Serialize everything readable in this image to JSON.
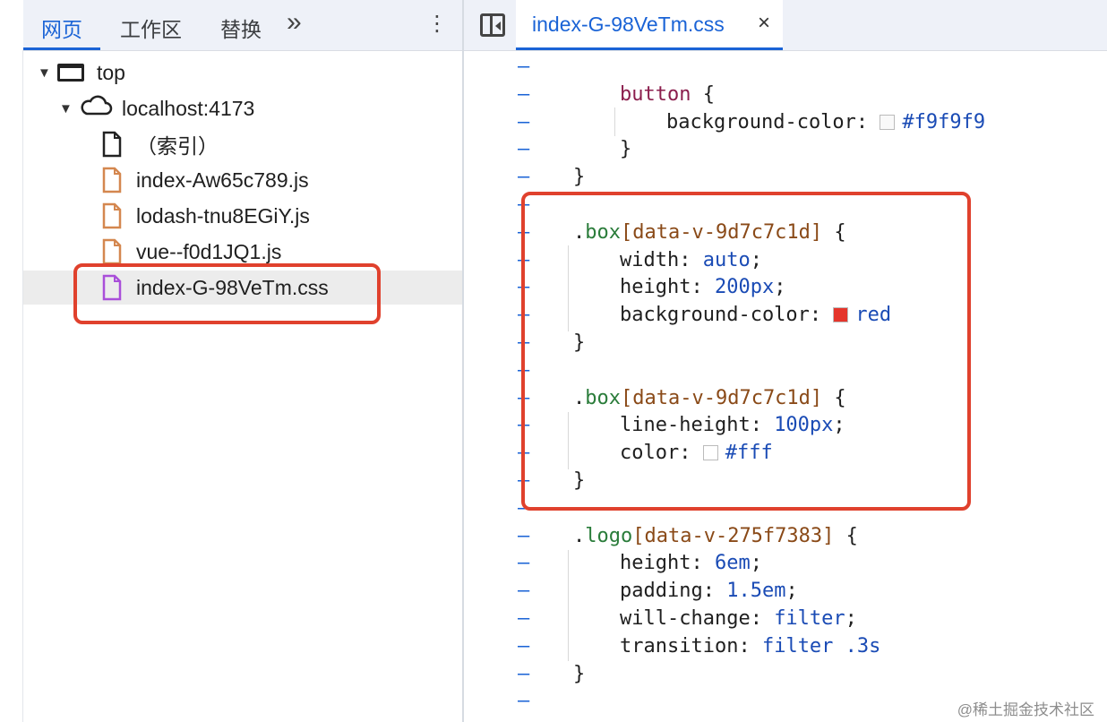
{
  "tabs": [
    {
      "label": "网页",
      "active": true
    },
    {
      "label": "工作区",
      "active": false
    },
    {
      "label": "替换",
      "active": false
    }
  ],
  "more_label": "»",
  "kebab_label": "⋮",
  "tree": {
    "top": "top",
    "host": "localhost:4173",
    "files": [
      {
        "name": "（索引）",
        "type": "document"
      },
      {
        "name": "index-Aw65c789.js",
        "type": "script"
      },
      {
        "name": "lodash-tnu8EGiY.js",
        "type": "script"
      },
      {
        "name": "vue--f0d1JQ1.js",
        "type": "script"
      },
      {
        "name": "index-G-98VeTm.css",
        "type": "stylesheet",
        "selected": true
      }
    ]
  },
  "editor": {
    "file_tab": "index-G-98VeTm.css",
    "close_label": "×",
    "marker": "–",
    "lines": [
      {
        "indent": 0,
        "parts": []
      },
      {
        "indent": 1,
        "parts": [
          [
            "kw",
            "button"
          ],
          [
            "sel",
            " {"
          ]
        ]
      },
      {
        "indent": 2,
        "parts": [
          [
            "prop",
            "background-color: "
          ],
          [
            "swatch",
            "#f9f9f9"
          ],
          [
            "val",
            "#f9f9f9"
          ]
        ]
      },
      {
        "indent": 1,
        "parts": [
          [
            "sel",
            "}"
          ]
        ]
      },
      {
        "indent": 0,
        "parts": [
          [
            "sel",
            "}"
          ]
        ]
      },
      {
        "indent": 0,
        "parts": []
      },
      {
        "indent": 0,
        "parts": [
          [
            "sel",
            "."
          ],
          [
            "cls",
            "box"
          ],
          [
            "attr",
            "[data-v-9d7c7c1d]"
          ],
          [
            "sel",
            " {"
          ]
        ]
      },
      {
        "indent": 1,
        "parts": [
          [
            "prop",
            "width: "
          ],
          [
            "val",
            "auto"
          ],
          [
            "prop",
            ";"
          ]
        ]
      },
      {
        "indent": 1,
        "parts": [
          [
            "prop",
            "height: "
          ],
          [
            "val",
            "200px"
          ],
          [
            "prop",
            ";"
          ]
        ]
      },
      {
        "indent": 1,
        "parts": [
          [
            "prop",
            "background-color: "
          ],
          [
            "swatch",
            "#e5352b"
          ],
          [
            "val",
            "red"
          ]
        ]
      },
      {
        "indent": 0,
        "parts": [
          [
            "sel",
            "}"
          ]
        ]
      },
      {
        "indent": 0,
        "parts": []
      },
      {
        "indent": 0,
        "parts": [
          [
            "sel",
            "."
          ],
          [
            "cls",
            "box"
          ],
          [
            "attr",
            "[data-v-9d7c7c1d]"
          ],
          [
            "sel",
            " {"
          ]
        ]
      },
      {
        "indent": 1,
        "parts": [
          [
            "prop",
            "line-height: "
          ],
          [
            "val",
            "100px"
          ],
          [
            "prop",
            ";"
          ]
        ]
      },
      {
        "indent": 1,
        "parts": [
          [
            "prop",
            "color: "
          ],
          [
            "swatch",
            "#ffffff"
          ],
          [
            "val",
            "#fff"
          ]
        ]
      },
      {
        "indent": 0,
        "parts": [
          [
            "sel",
            "}"
          ]
        ]
      },
      {
        "indent": 0,
        "parts": []
      },
      {
        "indent": 0,
        "parts": [
          [
            "sel",
            "."
          ],
          [
            "cls",
            "logo"
          ],
          [
            "attr",
            "[data-v-275f7383]"
          ],
          [
            "sel",
            " {"
          ]
        ]
      },
      {
        "indent": 1,
        "parts": [
          [
            "prop",
            "height: "
          ],
          [
            "val",
            "6em"
          ],
          [
            "prop",
            ";"
          ]
        ]
      },
      {
        "indent": 1,
        "parts": [
          [
            "prop",
            "padding: "
          ],
          [
            "val",
            "1.5em"
          ],
          [
            "prop",
            ";"
          ]
        ]
      },
      {
        "indent": 1,
        "parts": [
          [
            "prop",
            "will-change: "
          ],
          [
            "val",
            "filter"
          ],
          [
            "prop",
            ";"
          ]
        ]
      },
      {
        "indent": 1,
        "parts": [
          [
            "prop",
            "transition: "
          ],
          [
            "val",
            "filter .3s"
          ]
        ]
      },
      {
        "indent": 0,
        "parts": [
          [
            "sel",
            "}"
          ]
        ]
      },
      {
        "indent": 0,
        "parts": []
      }
    ]
  },
  "watermark": "@稀土掘金技术社区"
}
